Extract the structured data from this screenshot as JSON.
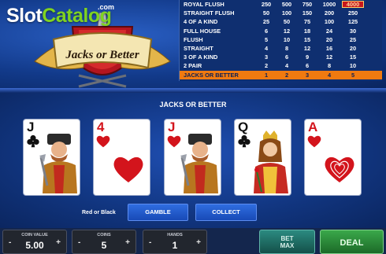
{
  "watermark": {
    "part1": "Slot",
    "part2": "Catalog",
    "suffix": ".com"
  },
  "logo": {
    "text": "Jacks or Better"
  },
  "paytable": {
    "rows": [
      {
        "hand": "ROYAL FLUSH",
        "pays": [
          "250",
          "500",
          "750",
          "1000",
          "4000"
        ]
      },
      {
        "hand": "STRAIGHT FLUSH",
        "pays": [
          "50",
          "100",
          "150",
          "200",
          "250"
        ]
      },
      {
        "hand": "4 OF A KIND",
        "pays": [
          "25",
          "50",
          "75",
          "100",
          "125"
        ]
      },
      {
        "hand": "FULL HOUSE",
        "pays": [
          "6",
          "12",
          "18",
          "24",
          "30"
        ]
      },
      {
        "hand": "FLUSH",
        "pays": [
          "5",
          "10",
          "15",
          "20",
          "25"
        ]
      },
      {
        "hand": "STRAIGHT",
        "pays": [
          "4",
          "8",
          "12",
          "16",
          "20"
        ]
      },
      {
        "hand": "3 OF A KIND",
        "pays": [
          "3",
          "6",
          "9",
          "12",
          "15"
        ]
      },
      {
        "hand": "2 PAIR",
        "pays": [
          "2",
          "4",
          "6",
          "8",
          "10"
        ]
      },
      {
        "hand": "JACKS OR BETTER",
        "pays": [
          "1",
          "2",
          "3",
          "4",
          "5"
        ]
      }
    ],
    "highlighted_row": 8,
    "highlighted_top_value": "4000"
  },
  "game_title": "JACKS OR BETTER",
  "cards": [
    {
      "rank": "J",
      "suit": "clubs",
      "color": "black",
      "figure": "jack"
    },
    {
      "rank": "4",
      "suit": "hearts",
      "color": "red",
      "figure": "pip"
    },
    {
      "rank": "J",
      "suit": "hearts",
      "color": "red",
      "figure": "jack"
    },
    {
      "rank": "Q",
      "suit": "clubs",
      "color": "black",
      "figure": "queen"
    },
    {
      "rank": "A",
      "suit": "hearts",
      "color": "red",
      "figure": "ace"
    }
  ],
  "controls": {
    "red_or_black_label": "Red or Black",
    "gamble_label": "GAMBLE",
    "collect_label": "COLLECT",
    "coin_value_label": "COIN VALUE",
    "coin_value": "5.00",
    "coins_label": "COINS",
    "coins": "5",
    "hands_label": "HANDS",
    "hands": "1",
    "bet_max_label_1": "BET",
    "bet_max_label_2": "MAX",
    "deal_label": "DEAL",
    "minus_symbol": "-",
    "plus_symbol": "+"
  },
  "colors": {
    "accent_orange": "#f07a10",
    "deal_green": "#2e8b3a",
    "bet_max_teal": "#1f6b63",
    "card_red": "#d3141c"
  }
}
